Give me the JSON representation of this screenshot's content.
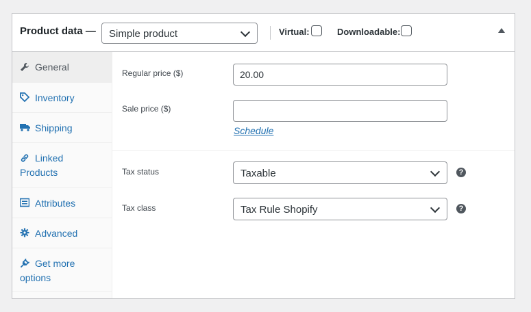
{
  "header": {
    "title": "Product data —",
    "product_type": "Simple product",
    "virtual_label": "Virtual:",
    "downloadable_label": "Downloadable:",
    "virtual_checked": false,
    "downloadable_checked": false
  },
  "tabs": [
    {
      "label": "General",
      "icon": "wrench-icon",
      "active": true
    },
    {
      "label": "Inventory",
      "icon": "tag-icon",
      "active": false
    },
    {
      "label": "Shipping",
      "icon": "truck-icon",
      "active": false
    },
    {
      "label_line1": "Linked",
      "label_line2": "Products",
      "icon": "link-icon",
      "active": false
    },
    {
      "label": "Attributes",
      "icon": "list-icon",
      "active": false
    },
    {
      "label": "Advanced",
      "icon": "gear-icon",
      "active": false
    },
    {
      "label_line1": "Get more",
      "label_line2": "options",
      "icon": "plugin-icon",
      "active": false
    }
  ],
  "general": {
    "regular_price_label": "Regular price ($)",
    "regular_price_value": "20.00",
    "sale_price_label": "Sale price ($)",
    "sale_price_value": "",
    "schedule_link": "Schedule",
    "tax_status_label": "Tax status",
    "tax_status_value": "Taxable",
    "tax_class_label": "Tax class",
    "tax_class_value": "Tax Rule Shopify",
    "help_glyph": "?"
  },
  "colors": {
    "accent": "#2271b1",
    "border": "#8c8f94",
    "active_tab_bg": "#eeeeee"
  }
}
